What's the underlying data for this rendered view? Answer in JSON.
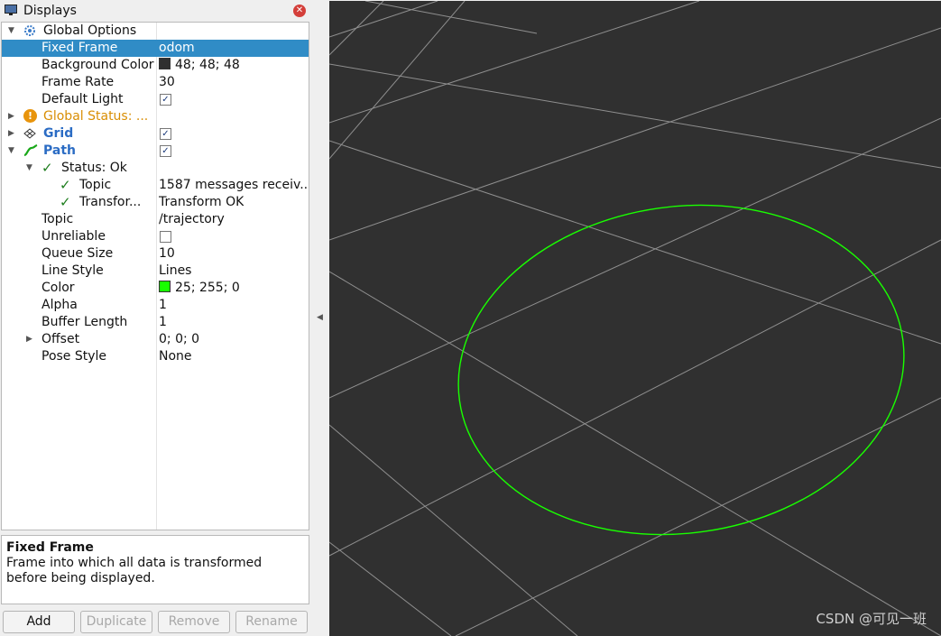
{
  "panel": {
    "title": "Displays"
  },
  "tree": {
    "global_options": {
      "label": "Global Options"
    },
    "fixed_frame": {
      "label": "Fixed Frame",
      "value": "odom"
    },
    "background_color": {
      "label": "Background Color",
      "value": "48; 48; 48",
      "swatch": "#303030"
    },
    "frame_rate": {
      "label": "Frame Rate",
      "value": "30"
    },
    "default_light": {
      "label": "Default Light",
      "checked": true
    },
    "global_status": {
      "label": "Global Status: ..."
    },
    "grid": {
      "label": "Grid",
      "checked": true
    },
    "path": {
      "label": "Path",
      "checked": true
    },
    "status_ok": {
      "label": "Status: Ok"
    },
    "status_topic": {
      "label": "Topic",
      "value": "1587 messages receiv..."
    },
    "status_transform": {
      "label": "Transfor...",
      "value": "Transform OK"
    },
    "topic": {
      "label": "Topic",
      "value": "/trajectory"
    },
    "unreliable": {
      "label": "Unreliable",
      "checked": false
    },
    "queue_size": {
      "label": "Queue Size",
      "value": "10"
    },
    "line_style": {
      "label": "Line Style",
      "value": "Lines"
    },
    "color": {
      "label": "Color",
      "value": "25; 255; 0",
      "swatch": "#19ff00"
    },
    "alpha": {
      "label": "Alpha",
      "value": "1"
    },
    "buffer_length": {
      "label": "Buffer Length",
      "value": "1"
    },
    "offset": {
      "label": "Offset",
      "value": "0; 0; 0"
    },
    "pose_style": {
      "label": "Pose Style",
      "value": "None"
    }
  },
  "description": {
    "title": "Fixed Frame",
    "text": "Frame into which all data is transformed before being displayed."
  },
  "buttons": {
    "add": "Add",
    "duplicate": "Duplicate",
    "remove": "Remove",
    "rename": "Rename"
  },
  "viewport": {
    "background": "#303030",
    "grid_color": "#a0a0a0",
    "path_color": "#19ff00"
  },
  "watermark": "CSDN @可见一班"
}
